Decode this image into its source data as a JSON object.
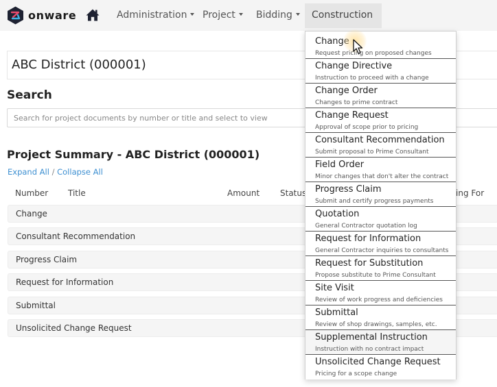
{
  "brand": {
    "name": "onware",
    "logo_icon": "hexagon-logo-icon",
    "accent_colors": [
      "#1e2232",
      "#e84b6c",
      "#3fb2e4"
    ]
  },
  "nav": {
    "home_icon": "home-icon",
    "items": [
      {
        "label": "Administration",
        "active": false
      },
      {
        "label": "Project",
        "active": false
      },
      {
        "label": "Bidding",
        "active": false
      },
      {
        "label": "Construction",
        "active": true
      }
    ]
  },
  "page": {
    "district_title": "ABC District (000001)",
    "search_heading": "Search",
    "search_placeholder": "Search for project documents by number or title and select to view",
    "summary_heading": "Project Summary - ABC District (000001)",
    "expand_all": "Expand All",
    "separator": " / ",
    "collapse_all": "Collapse All",
    "columns": [
      "Number",
      "Title",
      "Amount",
      "Status",
      "ing For"
    ],
    "rows": [
      "Change",
      "Consultant Recommendation",
      "Progress Claim",
      "Request for Information",
      "Submittal",
      "Unsolicited Change Request"
    ]
  },
  "dropdown": {
    "items": [
      {
        "title": "Change",
        "subtitle": "Request pricing on proposed changes"
      },
      {
        "title": "Change Directive",
        "subtitle": "Instruction to proceed with a change"
      },
      {
        "title": "Change Order",
        "subtitle": "Changes to prime contract"
      },
      {
        "title": "Change Request",
        "subtitle": "Approval of scope prior to pricing"
      },
      {
        "title": "Consultant Recommendation",
        "subtitle": "Submit proposal to Prime Consultant"
      },
      {
        "title": "Field Order",
        "subtitle": "Minor changes that don't alter the contract"
      },
      {
        "title": "Progress Claim",
        "subtitle": "Submit and certify progress payments"
      },
      {
        "title": "Quotation",
        "subtitle": "General Contractor quotation log"
      },
      {
        "title": "Request for Information",
        "subtitle": "General Contractor inquiries to consultants"
      },
      {
        "title": "Request for Substitution",
        "subtitle": "Propose substitute to Prime Consultant"
      },
      {
        "title": "Site Visit",
        "subtitle": "Review of work progress and deficiencies"
      },
      {
        "title": "Submittal",
        "subtitle": "Review of shop drawings, samples, etc."
      },
      {
        "title": "Supplemental Instruction",
        "subtitle": "Instruction with no contract impact"
      },
      {
        "title": "Unsolicited Change Request",
        "subtitle": "Pricing for a scope change"
      }
    ]
  }
}
